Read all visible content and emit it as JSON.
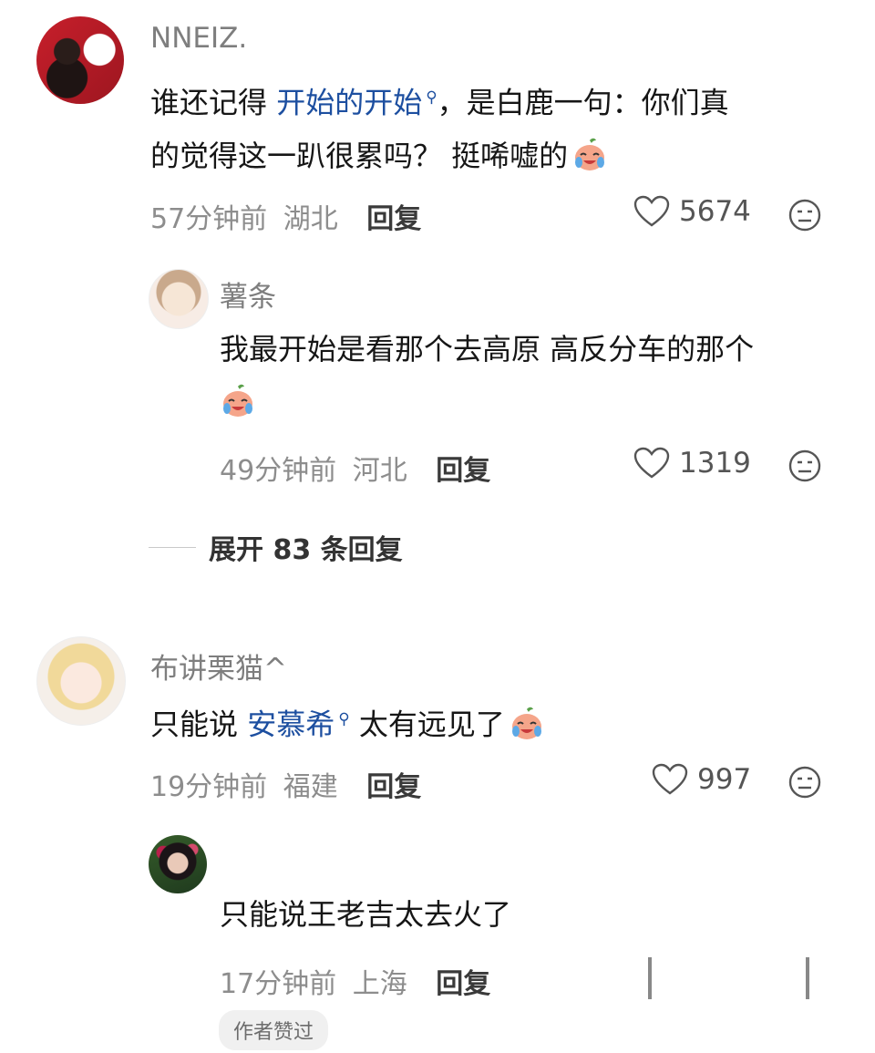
{
  "comments": [
    {
      "user": "NNEIZ.",
      "text_line1_pre": "谁还记得 ",
      "text_line1_link": "开始的开始",
      "text_line1_post": "，是白鹿一句：你们真",
      "text_line2": "的觉得这一趴很累吗？  挺唏嘘的",
      "time": "57分钟前",
      "location": "湖北",
      "reply_label": "回复",
      "likes": "5674"
    },
    {
      "user": "薯条",
      "text_line1": "我最开始是看那个去高原 高反分车的那个",
      "time": "49分钟前",
      "location": "河北",
      "reply_label": "回复",
      "likes": "1319"
    },
    {
      "user": "布讲栗猫^",
      "text_pre": "只能说 ",
      "text_link": "安慕希",
      "text_post": " 太有远见了",
      "time": "19分钟前",
      "location": "福建",
      "reply_label": "回复",
      "likes": "997"
    },
    {
      "user": "",
      "text_line1": "只能说王老吉太去火了",
      "time": "17分钟前",
      "location": "上海",
      "reply_label": "回复",
      "badge": "作者赞过"
    }
  ],
  "expand_label": "展开 83 条回复",
  "icons": {
    "heart": "heart-outline-icon",
    "dislike": "meh-face-icon",
    "search": "search-lens-icon",
    "emoji": "crying-laugh-emoji"
  }
}
